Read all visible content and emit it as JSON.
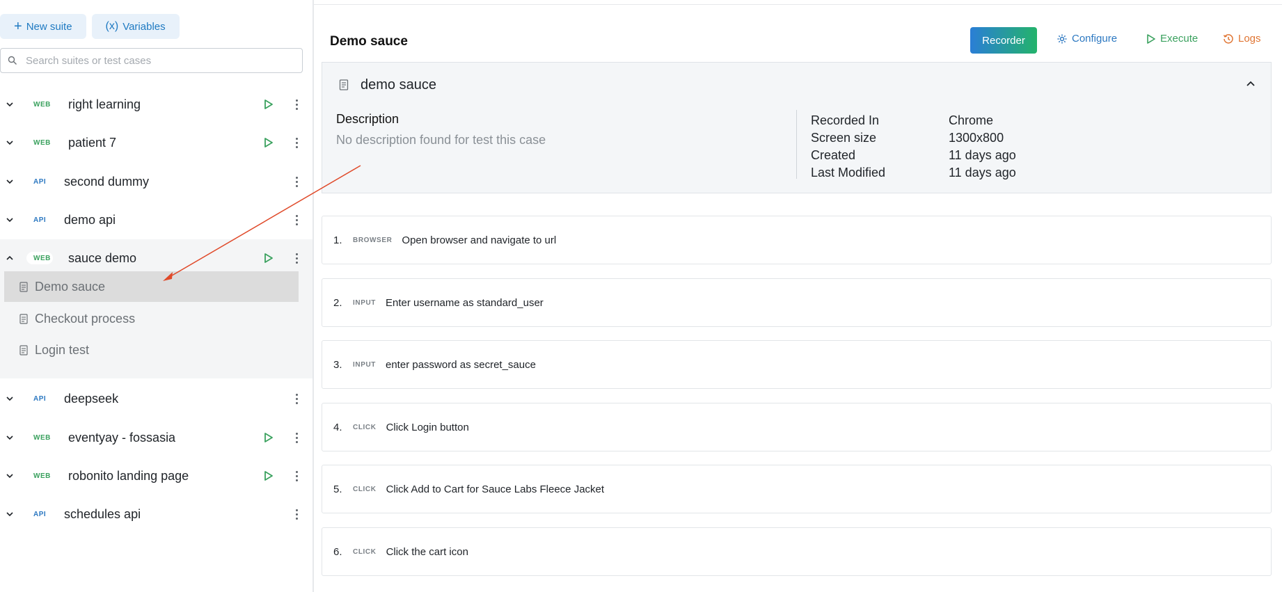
{
  "sidebar": {
    "new_suite_label": "New suite",
    "variables_label": "Variables",
    "variables_icon_text": "(x)",
    "search_placeholder": "Search suites or test cases",
    "suites": [
      {
        "type": "WEB",
        "name": "right learning",
        "expanded": false,
        "runnable": true
      },
      {
        "type": "WEB",
        "name": "patient 7",
        "expanded": false,
        "runnable": true
      },
      {
        "type": "API",
        "name": "second dummy",
        "expanded": false,
        "runnable": false
      },
      {
        "type": "API",
        "name": "demo api",
        "expanded": false,
        "runnable": false
      },
      {
        "type": "WEB",
        "name": "sauce demo",
        "expanded": true,
        "runnable": true
      },
      {
        "type": "API",
        "name": "deepseek",
        "expanded": false,
        "runnable": false
      },
      {
        "type": "WEB",
        "name": "eventyay - fossasia",
        "expanded": false,
        "runnable": true
      },
      {
        "type": "WEB",
        "name": "robonito landing page",
        "expanded": false,
        "runnable": true
      },
      {
        "type": "API",
        "name": "schedules api",
        "expanded": false,
        "runnable": false
      }
    ],
    "cases": [
      {
        "name": "Demo sauce",
        "active": true
      },
      {
        "name": "Checkout process",
        "active": false
      },
      {
        "name": "Login test",
        "active": false
      }
    ]
  },
  "header": {
    "title": "Demo sauce",
    "recorder_label": "Recorder",
    "configure_label": "Configure",
    "execute_label": "Execute",
    "logs_label": "Logs"
  },
  "info": {
    "card_title": "demo sauce",
    "description_label": "Description",
    "description_text": "No description found for test this case",
    "meta": [
      {
        "key": "Recorded In",
        "value": "Chrome"
      },
      {
        "key": "Screen size",
        "value": "1300x800"
      },
      {
        "key": "Created",
        "value": "11 days ago"
      },
      {
        "key": "Last Modified",
        "value": "11 days ago"
      }
    ]
  },
  "steps": [
    {
      "num": "1.",
      "type": "BROWSER",
      "text": "Open browser and navigate to url"
    },
    {
      "num": "2.",
      "type": "INPUT",
      "text": "Enter username as standard_user"
    },
    {
      "num": "3.",
      "type": "INPUT",
      "text": "enter password as secret_sauce"
    },
    {
      "num": "4.",
      "type": "CLICK",
      "text": "Click Login button"
    },
    {
      "num": "5.",
      "type": "CLICK",
      "text": "Click Add to Cart for Sauce Labs Fleece Jacket"
    },
    {
      "num": "6.",
      "type": "CLICK",
      "text": "Click the cart icon"
    }
  ],
  "colors": {
    "accent_blue": "#2c78c1",
    "accent_green": "#3aa15e",
    "accent_orange": "#e07533",
    "annotation_arrow": "#e04a2a"
  }
}
